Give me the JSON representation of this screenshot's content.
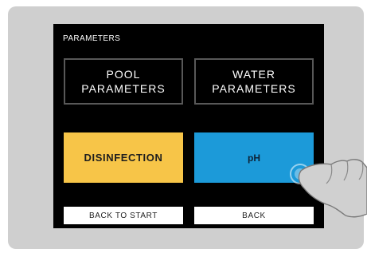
{
  "screen": {
    "title": "PARAMETERS"
  },
  "tiles": {
    "pool_parameters": "POOL\nPARAMETERS",
    "water_parameters": "WATER\nPARAMETERS",
    "disinfection": "DISINFECTION",
    "ph": "pH"
  },
  "buttons": {
    "back_to_start": "BACK TO START",
    "back": "BACK"
  },
  "icons": {
    "touch_hand": "pointing-hand-icon"
  },
  "colors": {
    "frame": "#cfcfcf",
    "screen_bg": "#000000",
    "tile_outline": "#585858",
    "disinfection": "#f7c548",
    "ph": "#1c9ad9",
    "button_bg": "#ffffff"
  }
}
